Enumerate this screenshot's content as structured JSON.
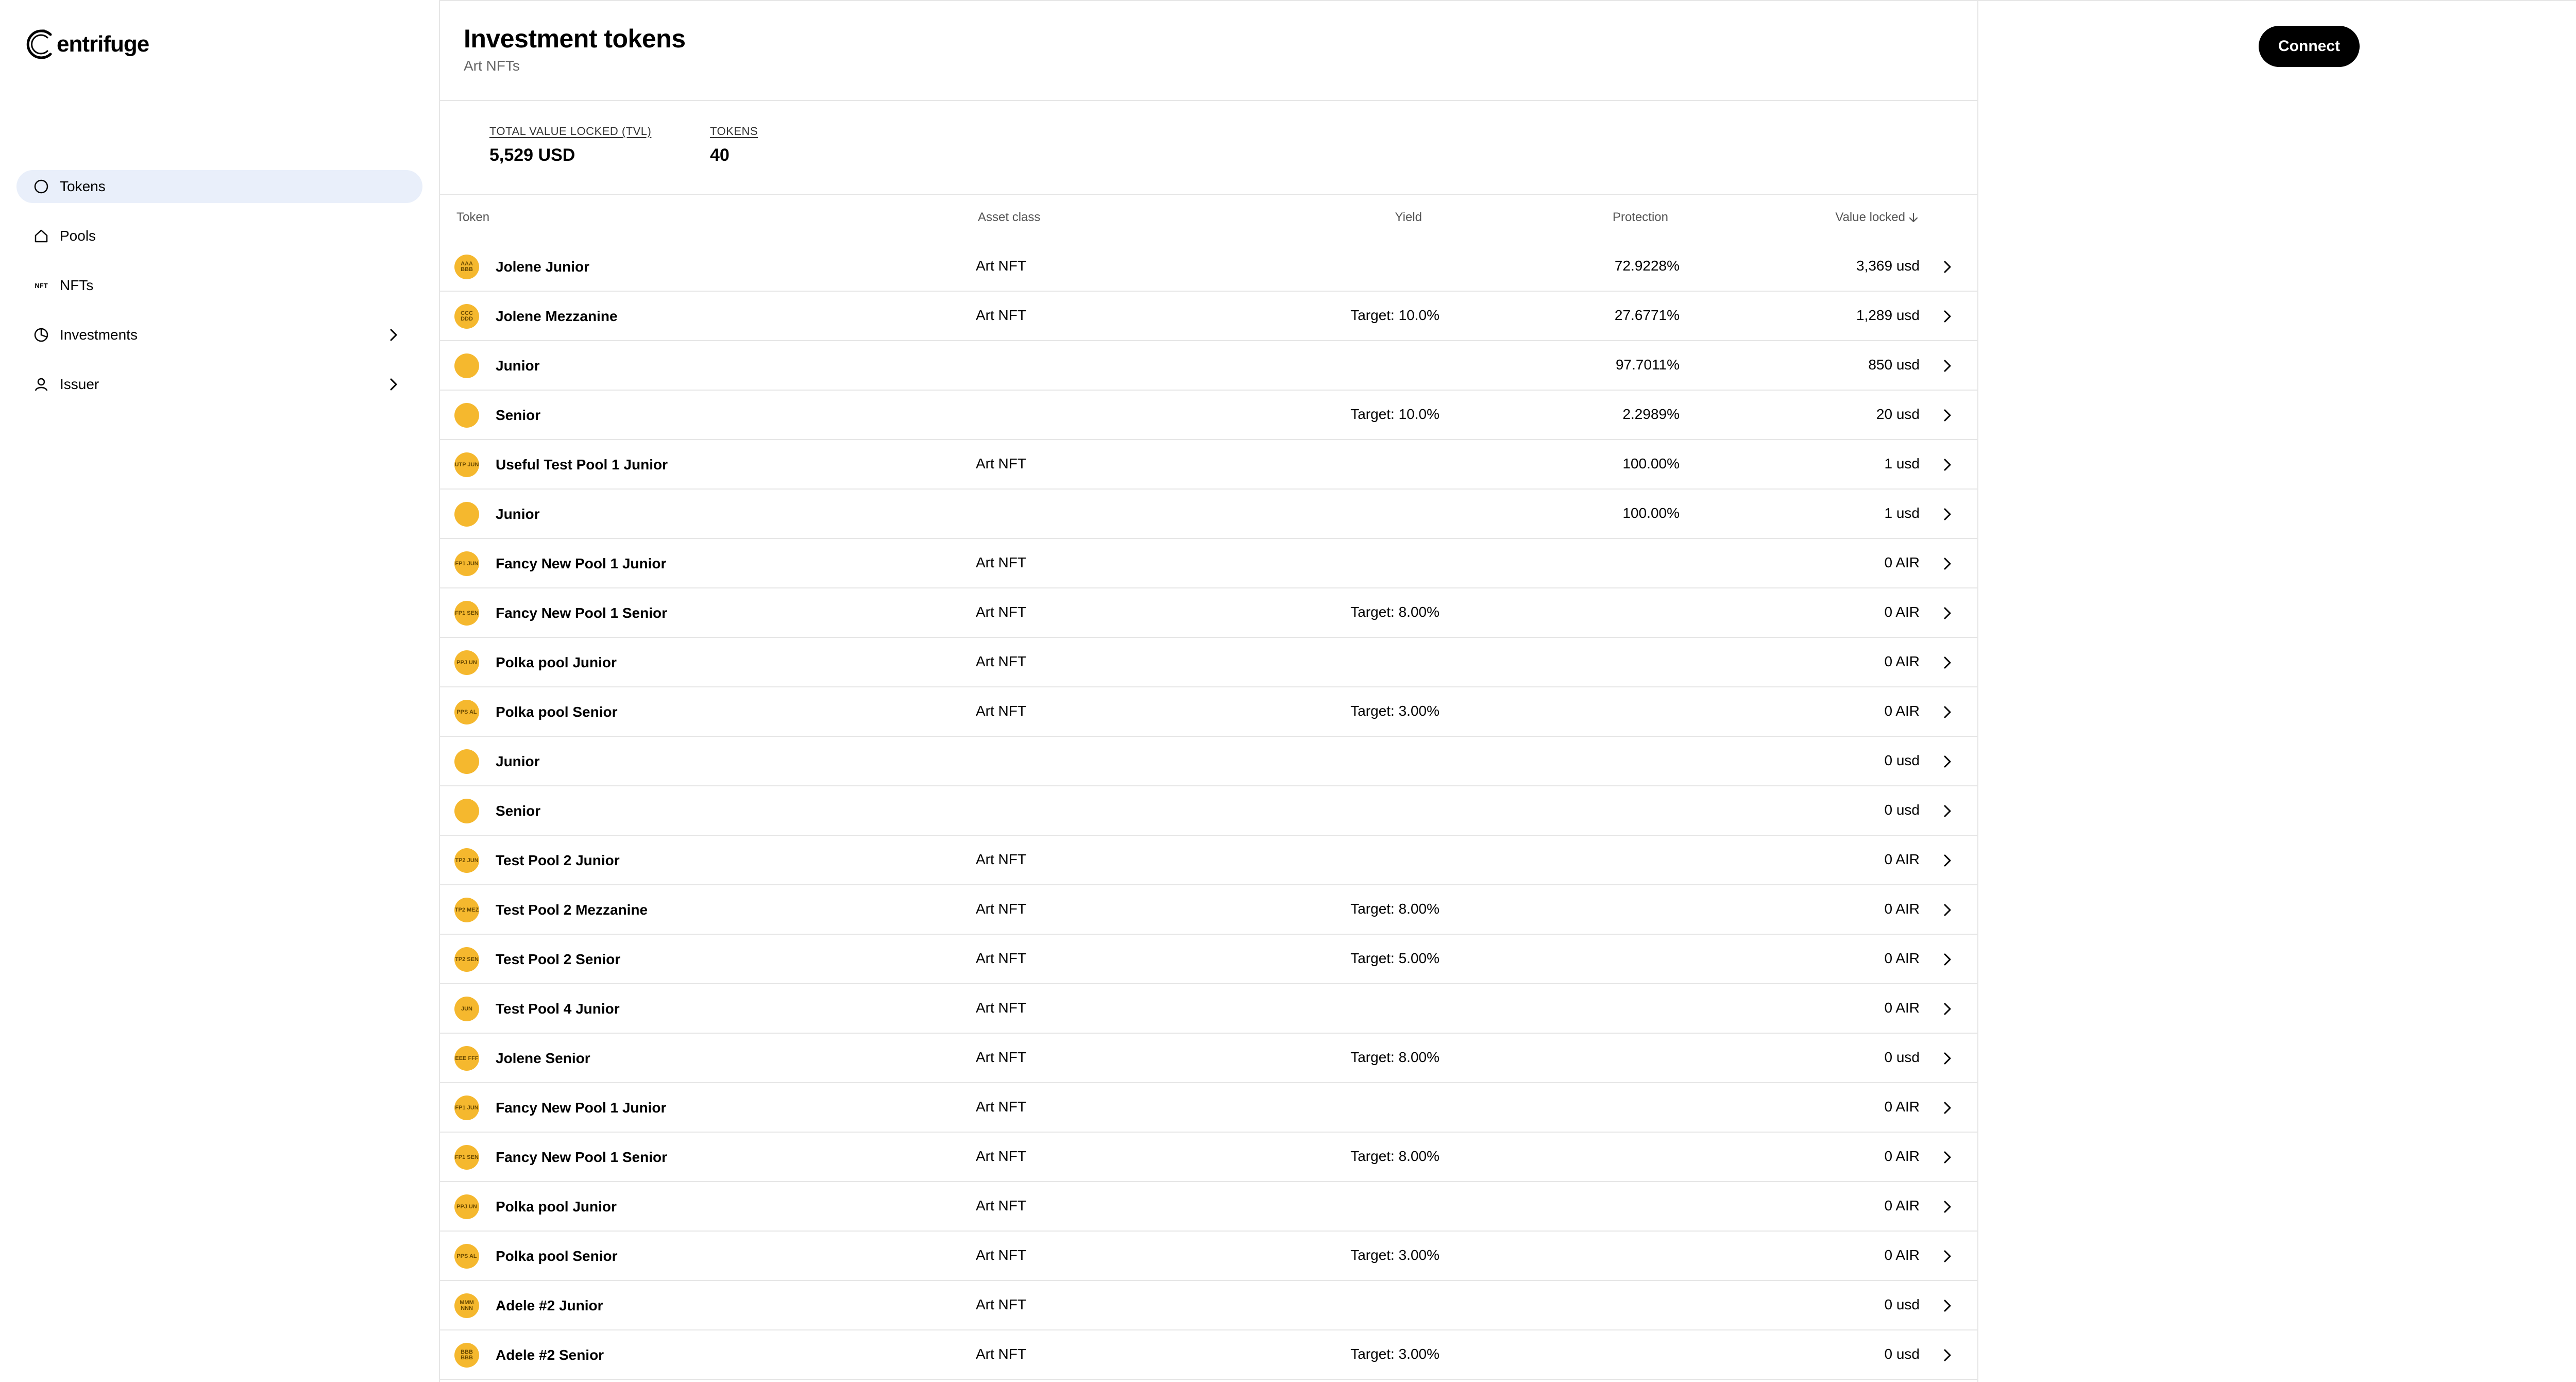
{
  "app": {
    "logo_text": "entrifuge"
  },
  "sidebar": {
    "items": [
      {
        "label": "Tokens",
        "active": true,
        "icon": "circle-icon"
      },
      {
        "label": "Pools",
        "icon": "home-icon"
      },
      {
        "label": "NFTs",
        "icon": "nft-icon",
        "glyph": "NFT"
      },
      {
        "label": "Investments",
        "icon": "pie-chart-icon",
        "expandable": true
      },
      {
        "label": "Issuer",
        "icon": "user-icon",
        "expandable": true
      }
    ]
  },
  "header": {
    "title": "Investment tokens",
    "subtitle": "Art NFTs"
  },
  "stats": {
    "tvl_label": "TOTAL VALUE LOCKED (TVL)",
    "tvl_value": "5,529 USD",
    "tokens_label": "TOKENS",
    "tokens_value": "40"
  },
  "connect_label": "Connect",
  "table": {
    "columns": {
      "token": "Token",
      "asset_class": "Asset class",
      "yield": "Yield",
      "protection": "Protection",
      "value_locked": "Value locked"
    },
    "rows": [
      {
        "icon": "AAA BBB",
        "name": "Jolene Junior",
        "asset": "Art NFT",
        "yield": "",
        "protection": "72.9228%",
        "value": "3,369 usd"
      },
      {
        "icon": "CCC DDD",
        "name": "Jolene Mezzanine",
        "asset": "Art NFT",
        "yield": "Target: 10.0%",
        "protection": "27.6771%",
        "value": "1,289 usd"
      },
      {
        "icon": "",
        "name": "Junior",
        "asset": "",
        "yield": "",
        "protection": "97.7011%",
        "value": "850 usd"
      },
      {
        "icon": "",
        "name": "Senior",
        "asset": "",
        "yield": "Target: 10.0%",
        "protection": "2.2989%",
        "value": "20 usd"
      },
      {
        "icon": "UTP JUN",
        "name": "Useful Test Pool 1 Junior",
        "asset": "Art NFT",
        "yield": "",
        "protection": "100.00%",
        "value": "1 usd"
      },
      {
        "icon": "",
        "name": "Junior",
        "asset": "",
        "yield": "",
        "protection": "100.00%",
        "value": "1 usd"
      },
      {
        "icon": "FP1 JUN",
        "name": "Fancy New Pool 1 Junior",
        "asset": "Art NFT",
        "yield": "",
        "protection": "",
        "value": "0 AIR"
      },
      {
        "icon": "FP1 SEN",
        "name": "Fancy New Pool 1 Senior",
        "asset": "Art NFT",
        "yield": "Target: 8.00%",
        "protection": "",
        "value": "0 AIR"
      },
      {
        "icon": "PPJ UN",
        "name": "Polka pool Junior",
        "asset": "Art NFT",
        "yield": "",
        "protection": "",
        "value": "0 AIR"
      },
      {
        "icon": "PPS AL",
        "name": "Polka pool Senior",
        "asset": "Art NFT",
        "yield": "Target: 3.00%",
        "protection": "",
        "value": "0 AIR"
      },
      {
        "icon": "",
        "name": "Junior",
        "asset": "",
        "yield": "",
        "protection": "",
        "value": "0 usd"
      },
      {
        "icon": "",
        "name": "Senior",
        "asset": "",
        "yield": "",
        "protection": "",
        "value": "0 usd"
      },
      {
        "icon": "TP2 JUN",
        "name": "Test Pool 2 Junior",
        "asset": "Art NFT",
        "yield": "",
        "protection": "",
        "value": "0 AIR"
      },
      {
        "icon": "TP2 MEZ",
        "name": "Test Pool 2 Mezzanine",
        "asset": "Art NFT",
        "yield": "Target: 8.00%",
        "protection": "",
        "value": "0 AIR"
      },
      {
        "icon": "TP2 SEN",
        "name": "Test Pool 2 Senior",
        "asset": "Art NFT",
        "yield": "Target: 5.00%",
        "protection": "",
        "value": "0 AIR"
      },
      {
        "icon": "JUN",
        "name": "Test Pool 4 Junior",
        "asset": "Art NFT",
        "yield": "",
        "protection": "",
        "value": "0 AIR"
      },
      {
        "icon": "EEE FFF",
        "name": "Jolene Senior",
        "asset": "Art NFT",
        "yield": "Target: 8.00%",
        "protection": "",
        "value": "0 usd"
      },
      {
        "icon": "FP1 JUN",
        "name": "Fancy New Pool 1 Junior",
        "asset": "Art NFT",
        "yield": "",
        "protection": "",
        "value": "0 AIR"
      },
      {
        "icon": "FP1 SEN",
        "name": "Fancy New Pool 1 Senior",
        "asset": "Art NFT",
        "yield": "Target: 8.00%",
        "protection": "",
        "value": "0 AIR"
      },
      {
        "icon": "PPJ UN",
        "name": "Polka pool Junior",
        "asset": "Art NFT",
        "yield": "",
        "protection": "",
        "value": "0 AIR"
      },
      {
        "icon": "PPS AL",
        "name": "Polka pool Senior",
        "asset": "Art NFT",
        "yield": "Target: 3.00%",
        "protection": "",
        "value": "0 AIR"
      },
      {
        "icon": "MMM NNN",
        "name": "Adele #2 Junior",
        "asset": "Art NFT",
        "yield": "",
        "protection": "",
        "value": "0 usd"
      },
      {
        "icon": "BBB BBB",
        "name": "Adele #2 Senior",
        "asset": "Art NFT",
        "yield": "Target: 3.00%",
        "protection": "",
        "value": "0 usd"
      }
    ]
  }
}
